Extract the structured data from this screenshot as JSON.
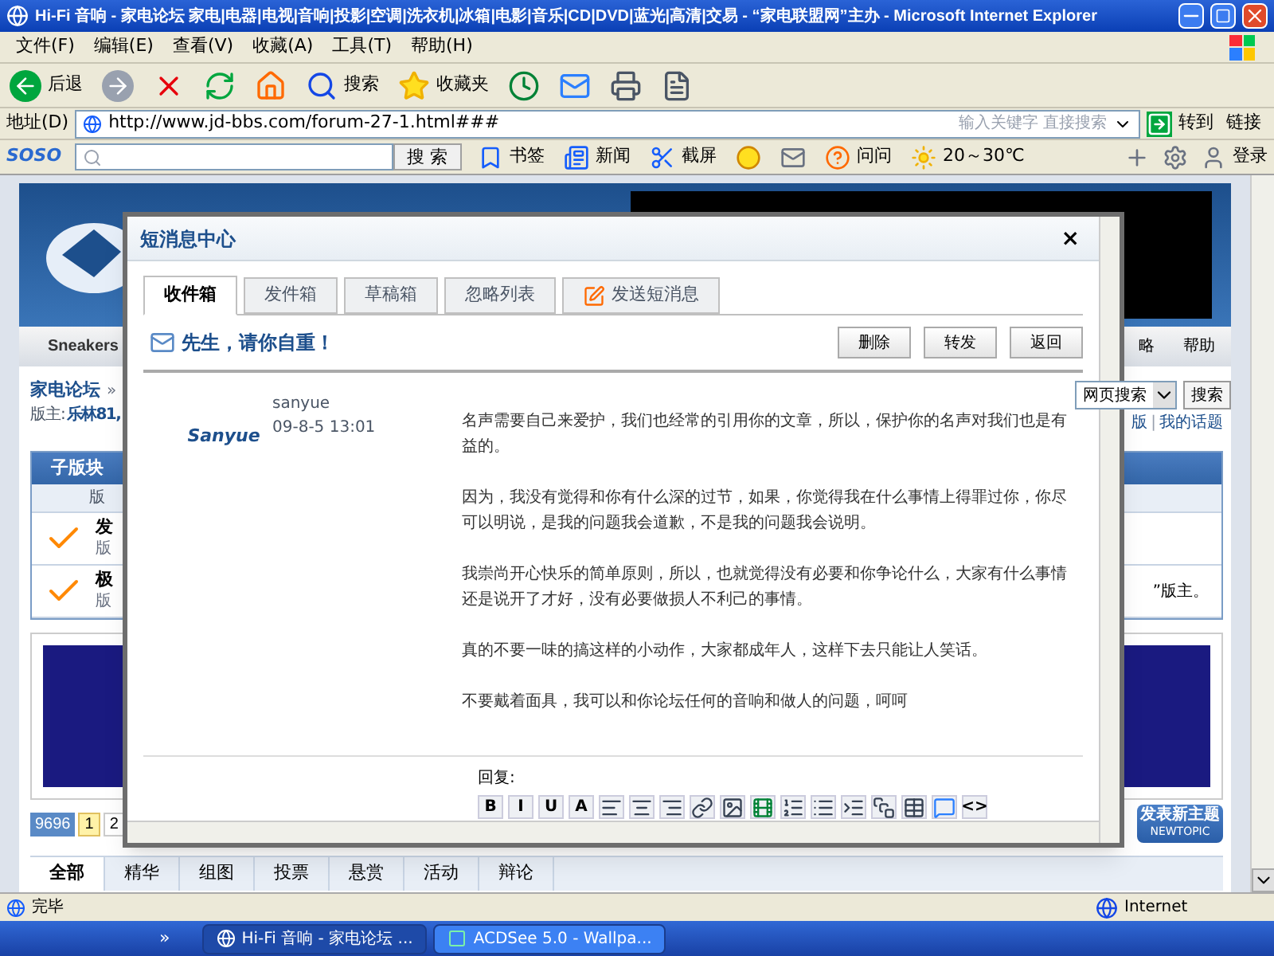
{
  "window": {
    "title": "Hi-Fi 音响 - 家电论坛 家电|电器|电视|音响|投影|空调|洗衣机|冰箱|电影|音乐|CD|DVD|蓝光|高清|交易 - “家电联盟网”主办 - Microsoft Internet Explorer"
  },
  "menu": [
    "文件(F)",
    "编辑(E)",
    "查看(V)",
    "收藏(A)",
    "工具(T)",
    "帮助(H)"
  ],
  "toolbar": [
    {
      "kind": "back",
      "label": "后退"
    },
    {
      "kind": "forward"
    },
    {
      "kind": "stop"
    },
    {
      "kind": "refresh"
    },
    {
      "kind": "home"
    },
    {
      "kind": "search",
      "label": "搜索"
    },
    {
      "kind": "favorites",
      "label": "收藏夹"
    },
    {
      "kind": "history"
    },
    {
      "kind": "mail"
    },
    {
      "kind": "print"
    },
    {
      "kind": "edit"
    }
  ],
  "address": {
    "label": "地址(D)",
    "value": "http://www.jd-bbs.com/forum-27-1.html###",
    "search_placeholder": "输入关键字 直接搜索",
    "go": "转到",
    "links": "链接"
  },
  "soso": {
    "logo": "SOSO",
    "search_button": "搜 索",
    "items": [
      {
        "kind": "bookmark",
        "label": "书签"
      },
      {
        "kind": "news",
        "label": "新闻"
      },
      {
        "kind": "screenshot",
        "label": "截屏"
      },
      {
        "kind": "coin"
      },
      {
        "kind": "mail"
      },
      {
        "kind": "ask",
        "label": "问问"
      },
      {
        "kind": "weather",
        "label": "20～30℃"
      }
    ],
    "login": "登录"
  },
  "page": {
    "nav_left": "Sneakers",
    "nav_right": [
      "略",
      "帮助"
    ],
    "breadcrumb": "家电论坛",
    "breadcrumb_sep": "»",
    "moderator_label": "版主:",
    "moderator": "乐林81,",
    "search_select": "网页搜索",
    "search_button": "搜索",
    "my_links": [
      "版",
      "我的话题"
    ],
    "my_links_separator": "|",
    "subforum_title": "子版块",
    "subforum_header": "版",
    "subforums": [
      {
        "name": "发",
        "moderator": "版"
      },
      {
        "name": "极",
        "moderator": "版"
      }
    ],
    "subforum_note": "”版主。",
    "page_count": "9696",
    "pages": [
      {
        "label": "1",
        "selected": true
      },
      {
        "label": "2",
        "selected": false
      }
    ],
    "new_topic": "发表新主题",
    "new_topic_sub": "NEWTOPIC",
    "tabs": [
      {
        "label": "全部",
        "selected": true
      },
      {
        "label": "精华",
        "selected": false
      },
      {
        "label": "组图",
        "selected": false
      },
      {
        "label": "投票",
        "selected": false
      },
      {
        "label": "悬赏",
        "selected": false
      },
      {
        "label": "活动",
        "selected": false
      },
      {
        "label": "辩论",
        "selected": false
      }
    ]
  },
  "dialog": {
    "title": "短消息中心",
    "close": "×",
    "tabs": [
      {
        "label": "收件箱",
        "selected": true,
        "kind": "plain"
      },
      {
        "label": "发件箱",
        "selected": false,
        "kind": "plain"
      },
      {
        "label": "草稿箱",
        "selected": false,
        "kind": "plain"
      },
      {
        "label": "忽略列表",
        "selected": false,
        "kind": "plain"
      },
      {
        "label": "发送短消息",
        "selected": false,
        "kind": "compose"
      }
    ],
    "subject": "先生，请你自重！",
    "actions": [
      "删除",
      "转发",
      "返回"
    ],
    "sender": {
      "name": "sanyue",
      "time": "09-8-5 13:01",
      "avatar_text": "Sanyue"
    },
    "paragraphs": [
      "名声需要自己来爱护，我们也经常的引用你的文章，所以，保护你的名声对我们也是有益的。",
      "因为，我没有觉得和你有什么深的过节，如果，你觉得我在什么事情上得罪过你，你尽可以明说，是我的问题我会道歉，不是我的问题我会说明。",
      "我崇尚开心快乐的简单原则，所以，也就觉得没有必要和你争论什么，大家有什么事情还是说开了才好，没有必要做损人不利己的事情。",
      "真的不要一味的搞这样的小动作，大家都成年人，这样下去只能让人笑话。",
      "不要戴着面具，我可以和你论坛任何的音响和做人的问题，呵呵"
    ],
    "reply_label": "回复:",
    "editor_tools": [
      {
        "kind": "text",
        "label": "B"
      },
      {
        "kind": "text",
        "label": "I"
      },
      {
        "kind": "text",
        "label": "U"
      },
      {
        "kind": "text",
        "label": "A"
      },
      {
        "kind": "align-left"
      },
      {
        "kind": "align-center"
      },
      {
        "kind": "align-right"
      },
      {
        "kind": "link"
      },
      {
        "kind": "image"
      },
      {
        "kind": "media"
      },
      {
        "kind": "ordered-list"
      },
      {
        "kind": "list"
      },
      {
        "kind": "indent"
      },
      {
        "kind": "block"
      },
      {
        "kind": "table"
      },
      {
        "kind": "quote"
      },
      {
        "kind": "text",
        "label": "<>"
      }
    ]
  },
  "status": {
    "text": "完毕",
    "zone": "Internet"
  },
  "taskbar": {
    "more": "»",
    "items": [
      {
        "label": "Hi-Fi 音响 - 家电论坛 ...",
        "selected": true,
        "kind": "ie"
      },
      {
        "label": "ACDSee 5.0 - Wallpa...",
        "selected": false,
        "kind": "acdsee"
      }
    ]
  }
}
